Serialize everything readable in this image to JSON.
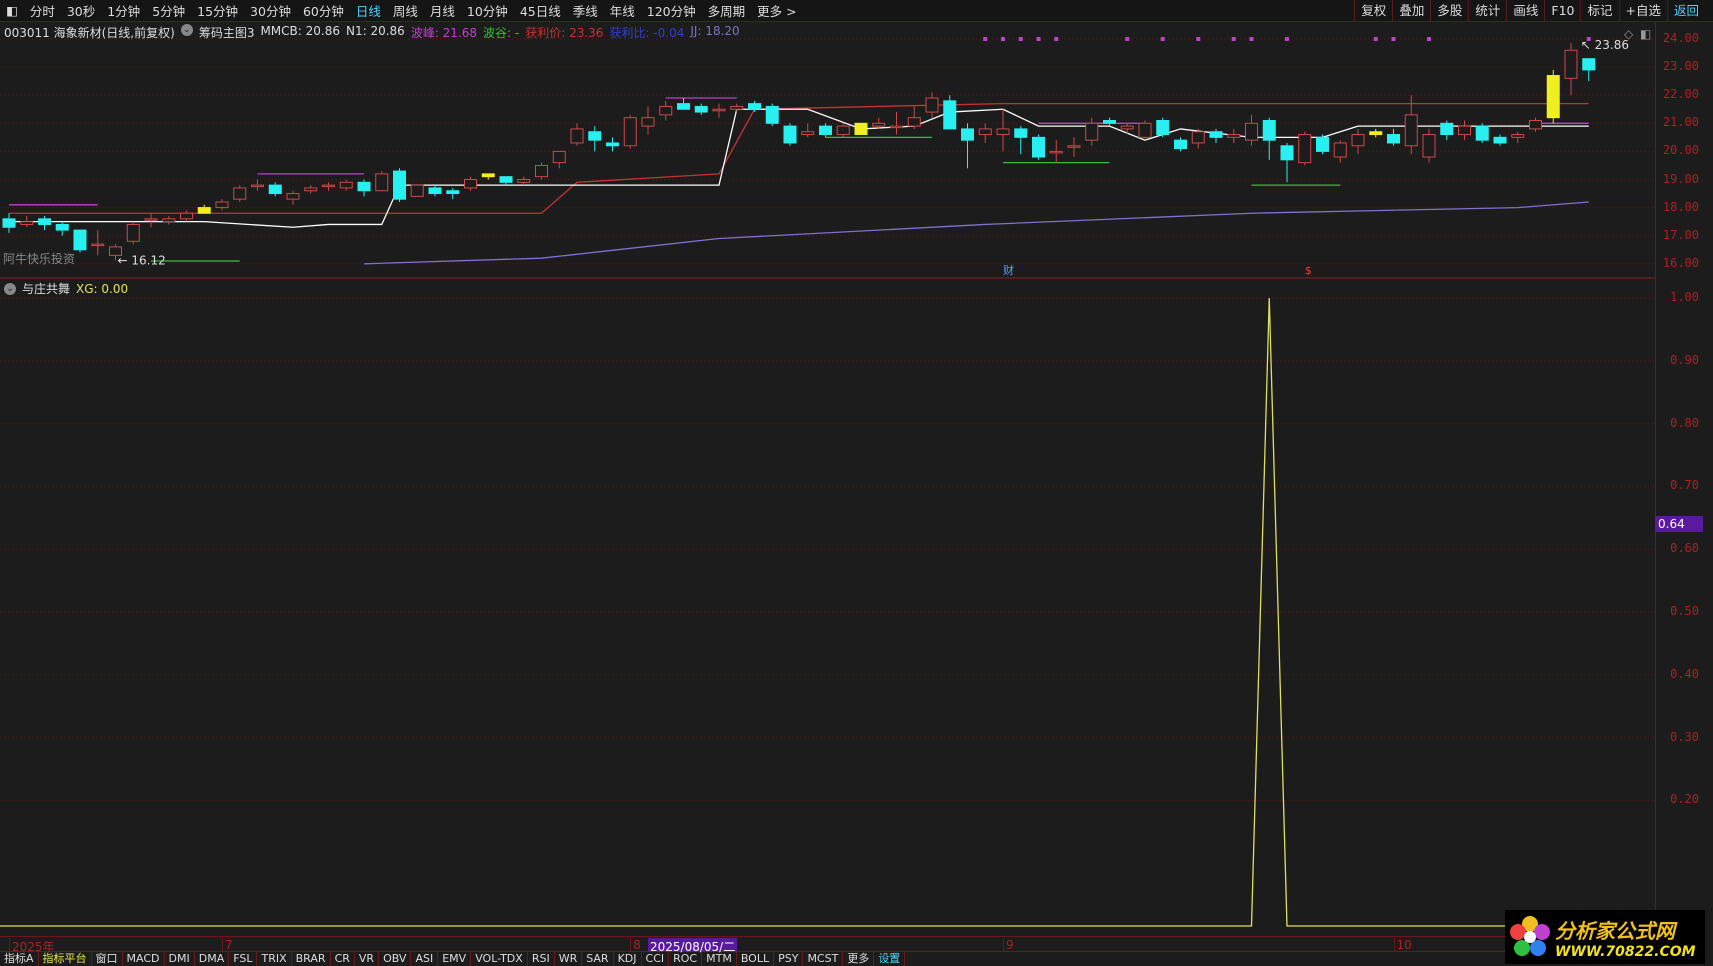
{
  "toolbar": {
    "periods": [
      "分时",
      "30秒",
      "1分钟",
      "5分钟",
      "15分钟",
      "30分钟",
      "60分钟",
      "日线",
      "周线",
      "月线",
      "10分钟",
      "45日线",
      "季线",
      "年线",
      "120分钟",
      "多周期",
      "更多 >"
    ],
    "active_period": "日线",
    "right": [
      "复权",
      "叠加",
      "多股",
      "统计",
      "画线",
      "F10",
      "标记",
      "+自选",
      "返回"
    ]
  },
  "info": {
    "stock": "003011 海象新材(日线,前复权)",
    "indicator": "筹码主图3",
    "mmcb": "MMCB: 20.86",
    "n1": "N1: 20.86",
    "peak_label": "波峰: 21.68",
    "valley_label": "波谷: -",
    "profit_price": "获利价: 23.36",
    "profit_ratio": "获利比: -0.04",
    "jj": "JJ: 18.20"
  },
  "colors": {
    "up": "#d04848",
    "down": "#28f0f0",
    "yellow": "#f0f020",
    "white": "#ffffff",
    "red_line": "#c83232",
    "ma": "#8070d0",
    "green": "#38c038",
    "magenta": "#c040d0",
    "xg": "#e0e060",
    "axis": "#b02020"
  },
  "upper": {
    "watermark_label": "阿牛快乐投资",
    "low_label": "16.12",
    "high_label": "23.86",
    "markers": [
      {
        "text": "财",
        "index": 56
      },
      {
        "text": "$",
        "index": 73
      }
    ],
    "y_ticks": [
      "24.00",
      "23.00",
      "22.00",
      "21.00",
      "20.00",
      "19.00",
      "18.00",
      "17.00",
      "16.00"
    ],
    "ylim": [
      15.9,
      24.3
    ]
  },
  "candles": [
    [
      17.6,
      17.3,
      17.8,
      17.1
    ],
    [
      17.4,
      17.5,
      17.7,
      17.3
    ],
    [
      17.6,
      17.4,
      17.7,
      17.2
    ],
    [
      17.4,
      17.2,
      17.5,
      17.0
    ],
    [
      17.2,
      16.5,
      17.2,
      16.4
    ],
    [
      16.7,
      16.7,
      17.2,
      16.3
    ],
    [
      16.3,
      16.6,
      16.7,
      16.12
    ],
    [
      16.8,
      17.4,
      17.5,
      16.7
    ],
    [
      17.6,
      17.6,
      17.8,
      17.3
    ],
    [
      17.5,
      17.6,
      17.7,
      17.4
    ],
    [
      17.6,
      17.8,
      17.9,
      17.5
    ],
    [
      17.8,
      18.0,
      18.1,
      17.8
    ],
    [
      18.0,
      18.2,
      18.3,
      17.9
    ],
    [
      18.3,
      18.7,
      18.8,
      18.2
    ],
    [
      18.8,
      18.8,
      19.0,
      18.6
    ],
    [
      18.8,
      18.5,
      18.9,
      18.4
    ],
    [
      18.3,
      18.5,
      18.6,
      18.1
    ],
    [
      18.6,
      18.7,
      18.8,
      18.5
    ],
    [
      18.8,
      18.8,
      18.9,
      18.6
    ],
    [
      18.7,
      18.9,
      19.0,
      18.6
    ],
    [
      18.9,
      18.6,
      19.0,
      18.4
    ],
    [
      18.6,
      19.2,
      19.3,
      18.6
    ],
    [
      19.3,
      18.3,
      19.4,
      18.2
    ],
    [
      18.4,
      18.8,
      18.8,
      18.4
    ],
    [
      18.7,
      18.5,
      18.8,
      18.4
    ],
    [
      18.6,
      18.5,
      18.7,
      18.3
    ],
    [
      18.7,
      19.0,
      19.1,
      18.6
    ],
    [
      19.1,
      19.2,
      19.2,
      19.0
    ],
    [
      19.1,
      18.9,
      19.1,
      18.8
    ],
    [
      18.9,
      19.0,
      19.1,
      18.8
    ],
    [
      19.1,
      19.5,
      19.6,
      19.0
    ],
    [
      19.6,
      20.0,
      20.0,
      19.4
    ],
    [
      20.3,
      20.8,
      21.0,
      20.2
    ],
    [
      20.7,
      20.4,
      20.9,
      20.0
    ],
    [
      20.3,
      20.2,
      20.5,
      20.0
    ],
    [
      20.2,
      21.2,
      21.3,
      20.1
    ],
    [
      20.9,
      21.2,
      21.6,
      20.6
    ],
    [
      21.3,
      21.6,
      21.8,
      21.1
    ],
    [
      21.7,
      21.5,
      21.9,
      21.5
    ],
    [
      21.6,
      21.4,
      21.7,
      21.3
    ],
    [
      21.5,
      21.5,
      21.7,
      21.2
    ],
    [
      21.5,
      21.6,
      21.7,
      21.4
    ],
    [
      21.7,
      21.5,
      21.8,
      21.4
    ],
    [
      21.6,
      21.0,
      21.7,
      20.9
    ],
    [
      20.9,
      20.3,
      21.0,
      20.2
    ],
    [
      20.6,
      20.7,
      21.0,
      20.5
    ],
    [
      20.9,
      20.6,
      21.0,
      20.5
    ],
    [
      20.6,
      20.9,
      21.0,
      20.5
    ],
    [
      21.0,
      20.6,
      21.0,
      20.6
    ],
    [
      20.9,
      21.0,
      21.2,
      20.8
    ],
    [
      20.9,
      20.9,
      21.4,
      20.6
    ],
    [
      20.9,
      21.2,
      21.6,
      20.8
    ],
    [
      21.4,
      21.9,
      22.1,
      21.2
    ],
    [
      21.8,
      20.8,
      22.0,
      20.8
    ],
    [
      20.8,
      20.4,
      21.0,
      19.4
    ],
    [
      20.6,
      20.8,
      21.0,
      20.3
    ],
    [
      20.6,
      20.8,
      21.5,
      20.0
    ],
    [
      20.8,
      20.5,
      20.9,
      19.9
    ],
    [
      20.5,
      19.8,
      20.6,
      19.7
    ],
    [
      20.0,
      20.0,
      20.4,
      19.6
    ],
    [
      20.2,
      20.2,
      20.5,
      19.8
    ],
    [
      20.4,
      21.0,
      21.2,
      20.2
    ],
    [
      21.1,
      21.0,
      21.2,
      20.9
    ],
    [
      20.8,
      20.9,
      21.0,
      20.6
    ],
    [
      20.5,
      21.0,
      21.1,
      20.4
    ],
    [
      21.1,
      20.6,
      21.2,
      20.5
    ],
    [
      20.4,
      20.1,
      20.5,
      20.0
    ],
    [
      20.3,
      20.7,
      20.8,
      20.1
    ],
    [
      20.7,
      20.5,
      20.8,
      20.3
    ],
    [
      20.5,
      20.6,
      20.8,
      20.3
    ],
    [
      20.4,
      21.0,
      21.3,
      20.2
    ],
    [
      21.1,
      20.4,
      21.2,
      19.7
    ],
    [
      20.2,
      19.7,
      20.3,
      18.9
    ],
    [
      19.6,
      20.6,
      20.7,
      19.5
    ],
    [
      20.5,
      20.0,
      20.6,
      19.9
    ],
    [
      19.8,
      20.3,
      20.4,
      19.6
    ],
    [
      20.2,
      20.6,
      20.8,
      19.9
    ],
    [
      20.6,
      20.7,
      20.8,
      20.5
    ],
    [
      20.6,
      20.3,
      20.8,
      20.2
    ],
    [
      20.2,
      21.3,
      22.0,
      19.9
    ],
    [
      19.8,
      20.6,
      20.8,
      19.6
    ],
    [
      21.0,
      20.6,
      21.1,
      20.4
    ],
    [
      20.6,
      20.9,
      21.1,
      20.4
    ],
    [
      20.9,
      20.4,
      21.0,
      20.3
    ],
    [
      20.5,
      20.3,
      20.6,
      20.2
    ],
    [
      20.5,
      20.6,
      20.7,
      20.3
    ],
    [
      20.8,
      21.1,
      21.2,
      20.7
    ],
    [
      21.2,
      22.7,
      22.9,
      21.0
    ],
    [
      22.6,
      23.6,
      23.86,
      22.0
    ],
    [
      23.3,
      22.9,
      23.3,
      22.5
    ]
  ],
  "yellow_candles": [
    11,
    27,
    48,
    77,
    87
  ],
  "lines": {
    "white": [
      [
        0,
        17.5
      ],
      [
        11,
        17.5
      ],
      [
        16,
        17.3
      ],
      [
        18,
        17.4
      ],
      [
        21,
        17.4
      ],
      [
        22,
        18.8
      ],
      [
        40,
        18.8
      ],
      [
        41,
        21.5
      ],
      [
        45,
        21.5
      ],
      [
        48,
        20.8
      ],
      [
        51,
        20.9
      ],
      [
        53,
        21.4
      ],
      [
        56,
        21.5
      ],
      [
        58,
        20.9
      ],
      [
        62,
        20.9
      ],
      [
        64,
        20.4
      ],
      [
        66,
        20.8
      ],
      [
        70,
        20.5
      ],
      [
        72,
        20.5
      ],
      [
        74,
        20.5
      ],
      [
        76,
        20.9
      ],
      [
        86,
        20.9
      ],
      [
        89,
        20.9
      ]
    ],
    "red": [
      [
        0,
        17.8
      ],
      [
        30,
        17.8
      ],
      [
        32,
        18.9
      ],
      [
        40,
        19.2
      ],
      [
        42,
        21.5
      ],
      [
        56,
        21.7
      ],
      [
        89,
        21.7
      ]
    ],
    "ma": [
      [
        20,
        16.0
      ],
      [
        30,
        16.2
      ],
      [
        40,
        16.9
      ],
      [
        55,
        17.4
      ],
      [
        70,
        17.8
      ],
      [
        85,
        18.0
      ],
      [
        89,
        18.2
      ]
    ],
    "green": [
      [
        [
          8,
          16.1
        ],
        [
          13,
          16.1
        ]
      ],
      [
        [
          46,
          20.5
        ],
        [
          52,
          20.5
        ]
      ],
      [
        [
          56,
          19.6
        ],
        [
          62,
          19.6
        ]
      ],
      [
        [
          70,
          18.8
        ],
        [
          75,
          18.8
        ]
      ]
    ],
    "magenta": [
      [
        [
          0,
          18.1
        ],
        [
          5,
          18.1
        ]
      ],
      [
        [
          14,
          19.2
        ],
        [
          20,
          19.2
        ]
      ],
      [
        [
          37,
          21.9
        ],
        [
          41,
          21.9
        ]
      ],
      [
        [
          58,
          21.0
        ],
        [
          64,
          21.0
        ]
      ],
      [
        [
          86,
          21.0
        ],
        [
          89,
          21.0
        ]
      ]
    ],
    "top_dots": [
      55,
      56,
      57,
      58,
      59,
      63,
      65,
      67,
      69,
      70,
      72,
      77,
      78,
      80,
      89
    ]
  },
  "lower": {
    "title": "与庄共舞",
    "xg_label": "XG: 0.00",
    "current_value": "0.64",
    "y_ticks": [
      "1.00",
      "0.90",
      "0.80",
      "0.70",
      "0.60",
      "0.50",
      "0.40",
      "0.30",
      "0.20"
    ],
    "ylim": [
      0,
      1
    ],
    "spike_index": 71
  },
  "dates": {
    "labels": [
      {
        "text": "2025年",
        "index": 0
      },
      {
        "text": "7",
        "index": 12
      },
      {
        "text": "8",
        "index": 35
      },
      {
        "text": "9",
        "index": 56
      },
      {
        "text": "10",
        "index": 78
      }
    ],
    "selected": {
      "text": "2025/08/05/二",
      "index": 36
    }
  },
  "tabs": [
    "指标A",
    "指标平台",
    "窗口",
    "MACD",
    "DMI",
    "DMA",
    "FSL",
    "TRIX",
    "BRAR",
    "CR",
    "VR",
    "OBV",
    "ASI",
    "EMV",
    "VOL-TDX",
    "RSI",
    "WR",
    "SAR",
    "KDJ",
    "CCI",
    "ROC",
    "MTM",
    "BOLL",
    "PSY",
    "MCST",
    "更多",
    "设置"
  ],
  "logo": {
    "title": "分析家公式网",
    "url": "WWW.70822.COM"
  }
}
